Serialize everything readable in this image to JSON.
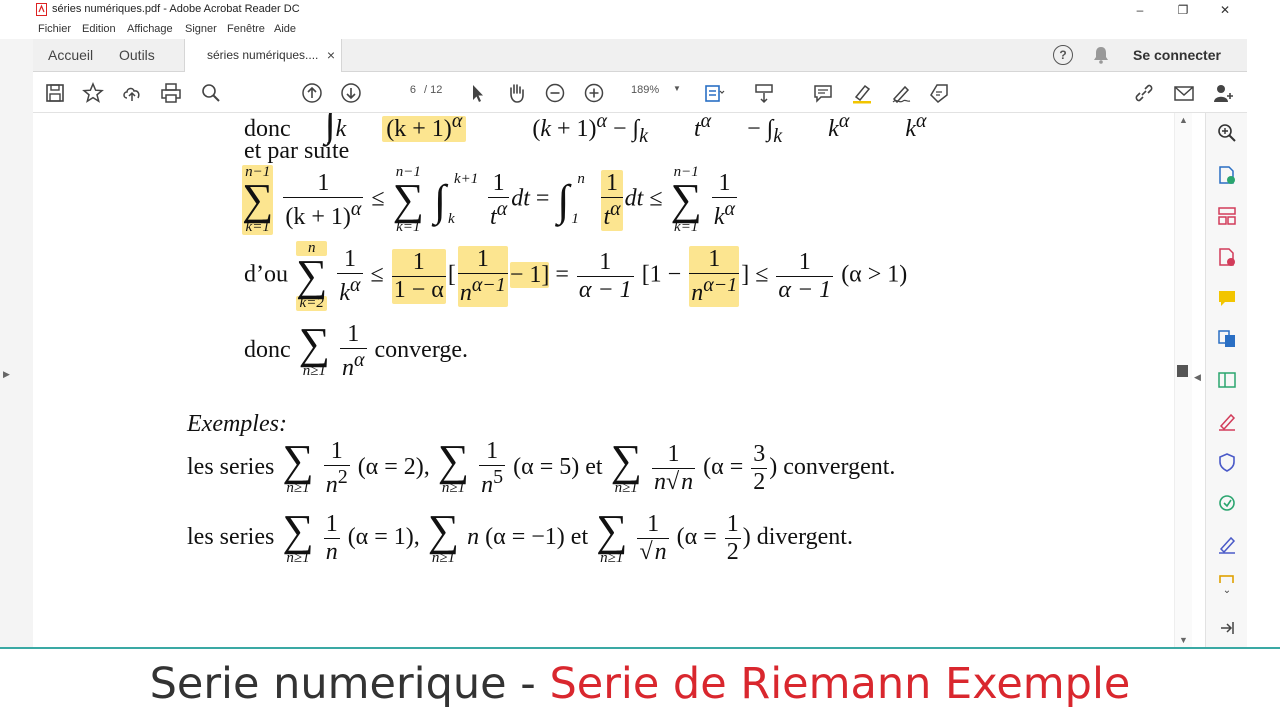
{
  "window": {
    "title": "séries numériques.pdf - Adobe Acrobat Reader DC",
    "controls": {
      "minimize": "–",
      "maximize": "❐",
      "close": "✕"
    }
  },
  "menu": [
    "Fichier",
    "Edition",
    "Affichage",
    "Signer",
    "Fenêtre",
    "Aide"
  ],
  "tabs": {
    "home": "Accueil",
    "tools": "Outils",
    "document": "séries numériques....",
    "close": "×"
  },
  "account": {
    "help": "?",
    "signin": "Se connecter"
  },
  "toolbar": {
    "page_current": "6",
    "page_total": "/ 12",
    "zoom": "189%",
    "icons": [
      "save-icon",
      "star-icon",
      "cloud-upload-icon",
      "print-icon",
      "search-icon",
      "page-up-icon",
      "page-down-icon",
      "select-cursor-icon",
      "hand-icon",
      "zoom-out-icon",
      "zoom-in-icon",
      "fit-page-icon",
      "scroll-mode-icon",
      "comment-icon",
      "highlight-icon",
      "sign-icon",
      "stamp-icon",
      "share-link-icon",
      "mail-icon",
      "add-user-icon"
    ]
  },
  "document": {
    "line0": {
      "a": "donc",
      "b": "(k + 1)",
      "alpha": "α"
    },
    "line1": "et par suite",
    "line2": {
      "sum_top": "n−1",
      "sum_bot": "k=1",
      "num": "1",
      "den": "(k + 1)",
      "alpha": "α",
      "le": "≤",
      "int_top": "k+1",
      "int_bot": "k",
      "t": "t",
      "dt": "dt",
      "eq": "=",
      "int2_top": "n",
      "int2_bot": "1",
      "k": "k"
    },
    "line3": {
      "prefix": "d’ou",
      "sum_top": "n",
      "sum_bot": "k=2",
      "one": "1",
      "minus_alpha": "1 − α",
      "n_exp": "n",
      "exp": "α−1",
      "minus1": "− 1]",
      "alpha_m1": "α − 1",
      "one_minus": "[1 −",
      "close": "]",
      "cond": "(α > 1)"
    },
    "line4": {
      "prefix": "donc",
      "sum_bot": "n≥1",
      "den": "n",
      "alpha": "α",
      "suffix": "converge."
    },
    "examples_title": "Exemples:",
    "ex1": {
      "prefix": "les series",
      "sum_bot": "n≥1",
      "d1": "n",
      "e1": "2",
      "c1": "(α = 2),",
      "d2": "n",
      "e2": "5",
      "c2": "(α = 5) et",
      "d3a": "n",
      "d3b": "n",
      "c3a": "(α =",
      "f_num": "3",
      "f_den": "2",
      "suffix": ") convergent."
    },
    "ex2": {
      "prefix": "les series",
      "sum_bot": "n≥1",
      "d1": "n",
      "c1": "(α = 1),",
      "mid": "n",
      "c2": "(α = −1) et",
      "d3": "n",
      "c3a": "(α =",
      "f_num": "1",
      "f_den": "2",
      "suffix": ") divergent."
    }
  },
  "caption": {
    "part1": "Serie numerique - ",
    "part2": "Serie de Riemann Exemple"
  },
  "colors": {
    "accent_red": "#d9272e",
    "highlight": "#fce590",
    "teal_line": "#3aa9a4"
  }
}
